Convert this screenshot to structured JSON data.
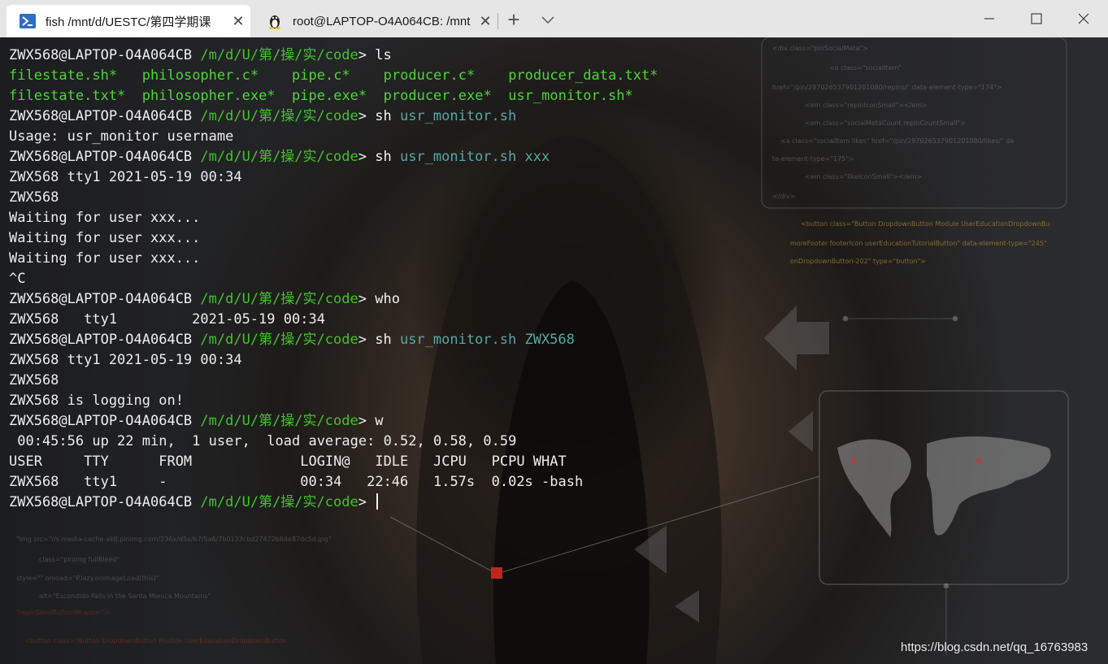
{
  "tabs": [
    {
      "title": "fish  /mnt/d/UESTC/第四学期课",
      "icon": "powershell-icon",
      "active": true
    },
    {
      "title": "root@LAPTOP-O4A064CB: /mnt",
      "icon": "linux-tux-icon",
      "active": false
    }
  ],
  "prompt": {
    "user": "ZWX568@LAPTOP-O4A064CB",
    "path": "/m/d/U/第/操/实/code",
    "symbol": ">"
  },
  "terminal": {
    "cmd_ls": "ls",
    "ls_row1": [
      "filestate.sh*",
      "philosopher.c*",
      "pipe.c*",
      "producer.c*",
      "producer_data.txt*"
    ],
    "ls_row2": [
      "filestate.txt*",
      "philosopher.exe*",
      "pipe.exe*",
      "producer.exe*",
      "usr_monitor.sh*"
    ],
    "cmd_sh": "sh",
    "arg1": "usr_monitor.sh",
    "usage": "Usage: usr_monitor username",
    "arg2": "usr_monitor.sh xxx",
    "out_tty1": "ZWX568 tty1 2021-05-19 00:34",
    "out_user": "ZWX568",
    "waiting": "Waiting for user xxx...",
    "ctrl_c": "^C",
    "cmd_who": "who",
    "who_out": "ZWX568   tty1         2021-05-19 00:34",
    "arg3": "usr_monitor.sh ZWX568",
    "out_tty1_b": "ZWX568 tty1 2021-05-19 00:34",
    "out_user_b": "ZWX568",
    "logging_on": "ZWX568 is logging on!",
    "cmd_w": "w",
    "w_uptime": " 00:45:56 up 22 min,  1 user,  load average: 0.52, 0.58, 0.59",
    "w_header": "USER     TTY      FROM             LOGIN@   IDLE   JCPU   PCPU WHAT",
    "w_row": "ZWX568   tty1     -                00:34   22:46   1.57s  0.02s -bash"
  },
  "watermark": "https://blog.csdn.net/qq_16763983",
  "colors": {
    "prompt_path": "#43c22c",
    "executable": "#4fd33b",
    "argument": "#55a9a6",
    "text": "#ececec",
    "titlebar": "#e6e6e6"
  }
}
